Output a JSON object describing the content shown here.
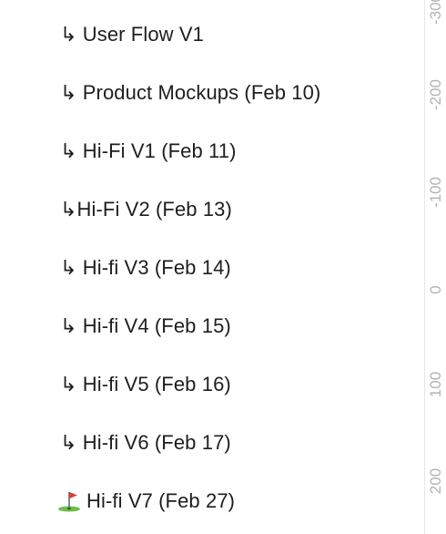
{
  "pages": [
    {
      "label": "↳ User Flow V1",
      "icon": null
    },
    {
      "label": "↳ Product Mockups (Feb 10)",
      "icon": null
    },
    {
      "label": "↳ Hi-Fi V1 (Feb 11)",
      "icon": null
    },
    {
      "label": "↳Hi-Fi V2 (Feb 13)",
      "icon": null
    },
    {
      "label": "↳ Hi-fi V3 (Feb 14)",
      "icon": null
    },
    {
      "label": "↳ Hi-fi V4 (Feb 15)",
      "icon": null
    },
    {
      "label": "↳ Hi-fi V5 (Feb 16)",
      "icon": null
    },
    {
      "label": "↳ Hi-fi V6 (Feb 17)",
      "icon": null
    },
    {
      "label": "Hi-fi V7 (Feb 27)",
      "icon": "golf-flag-icon"
    }
  ],
  "ruler": {
    "ticks": [
      "-300",
      "-200",
      "-100",
      "0",
      "100",
      "200"
    ]
  },
  "colors": {
    "text": "#1e1e1e",
    "ruler_text": "#b3b3b3",
    "ruler_border": "#e6e6e6",
    "flag_red": "#e53935",
    "flag_green": "#6cc04a"
  }
}
